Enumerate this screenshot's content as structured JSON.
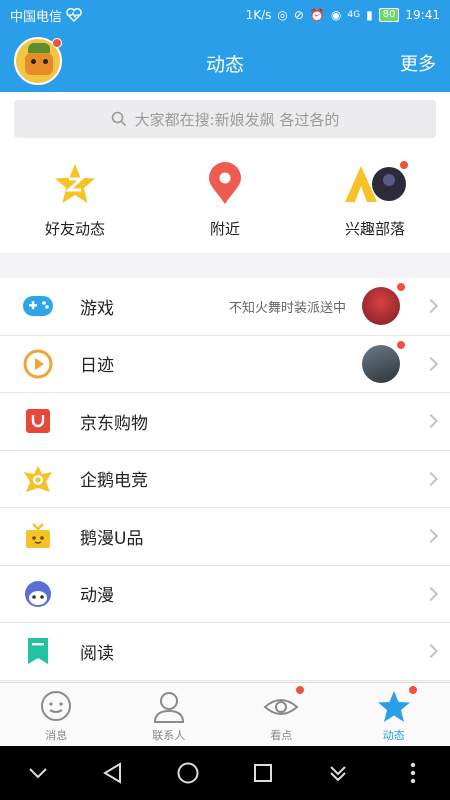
{
  "status_bar": {
    "carrier": "中国电信",
    "network_speed": "1K/s",
    "signal": "4G",
    "battery": "80",
    "time": "19:41"
  },
  "header": {
    "title": "动态",
    "more_label": "更多"
  },
  "search": {
    "placeholder": "大家都在搜:新娘发飙 各过各的"
  },
  "quick_entries": [
    {
      "label": "好友动态",
      "icon": "star-z-icon"
    },
    {
      "label": "附近",
      "icon": "location-pin-icon"
    },
    {
      "label": "兴趣部落",
      "icon": "tribe-tent-icon"
    }
  ],
  "list_items": [
    {
      "label": "游戏",
      "icon": "gamepad-icon",
      "extra_text": "不知火舞时装派送中"
    },
    {
      "label": "日迹",
      "icon": "play-circle-icon"
    },
    {
      "label": "京东购物",
      "icon": "jd-bag-icon"
    },
    {
      "label": "企鹅电竞",
      "icon": "esports-crown-icon"
    },
    {
      "label": "鹅漫U品",
      "icon": "gift-box-icon"
    },
    {
      "label": "动漫",
      "icon": "anime-face-icon"
    },
    {
      "label": "阅读",
      "icon": "bookmark-icon"
    }
  ],
  "tabs": [
    {
      "label": "消息",
      "icon": "chat-bubble-icon",
      "active": false
    },
    {
      "label": "联系人",
      "icon": "contact-person-icon",
      "active": false
    },
    {
      "label": "看点",
      "icon": "eye-icon",
      "active": false
    },
    {
      "label": "动态",
      "icon": "star-icon",
      "active": true
    }
  ],
  "colors": {
    "brand_blue": "#2a9ee8",
    "badge_red": "#f1523b",
    "star_yellow": "#f5c228",
    "pin_red": "#ef5c4f"
  }
}
